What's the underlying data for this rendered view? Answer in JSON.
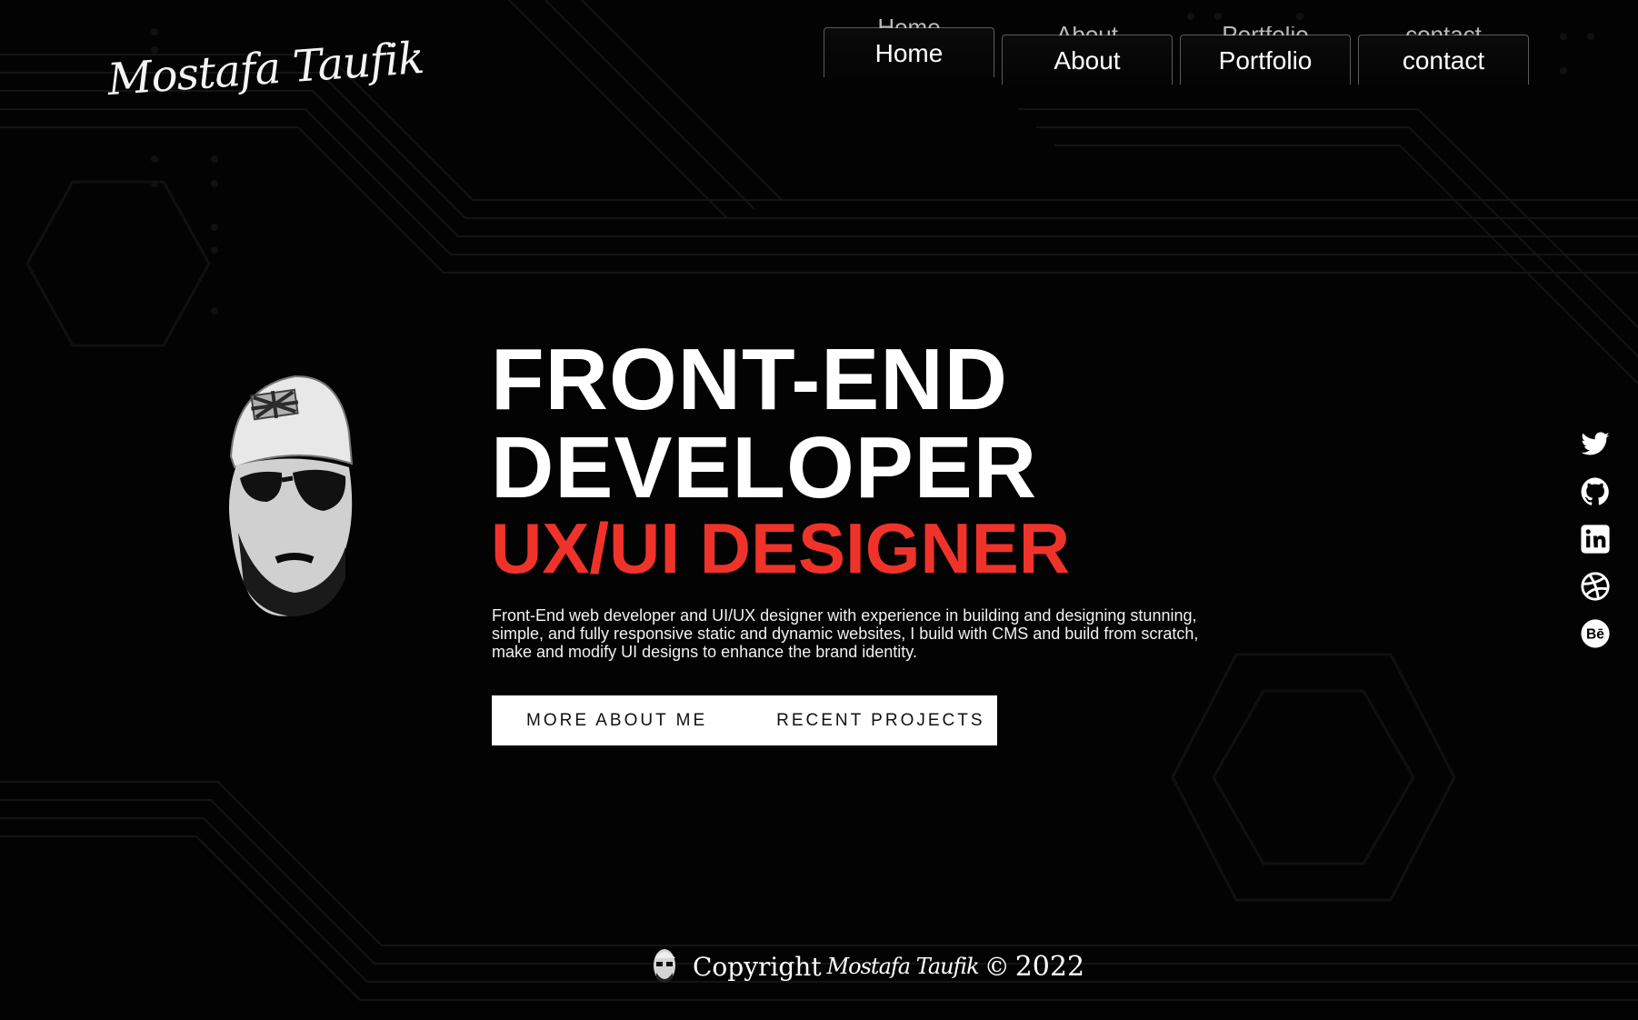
{
  "logo": {
    "text": "Mostafa Taufik"
  },
  "nav": {
    "items": [
      {
        "label": "Home"
      },
      {
        "label": "About"
      },
      {
        "label": "Portfolio"
      },
      {
        "label": "contact"
      }
    ]
  },
  "hero": {
    "line1": "FRONT-END",
    "line2": "DEVELOPER",
    "line3": "UX/UI DESIGNER",
    "intro_lines": [
      "Front-End web developer and UI/UX designer with experience in building and designing stunning,",
      "simple, and fully responsive static and dynamic websites, I build with CMS and build from scratch,",
      "make and modify UI designs to enhance the brand identity."
    ]
  },
  "buttons": {
    "about": "MORE ABOUT ME",
    "projects": "RECENT PROJECTS"
  },
  "social": {
    "icons": [
      "twitter-icon",
      "github-icon",
      "linkedin-icon",
      "dribbble-icon",
      "behance-icon"
    ],
    "behance_glyph": "Bē"
  },
  "footer": {
    "prefix": "Copyright",
    "name": "Mostafa Taufik",
    "symbol": "©",
    "year": "2022"
  },
  "colors": {
    "background": "#030303",
    "accent": "#f0332a",
    "text": "#ffffff",
    "button_bg": "#ffffff",
    "button_text": "#111111"
  }
}
